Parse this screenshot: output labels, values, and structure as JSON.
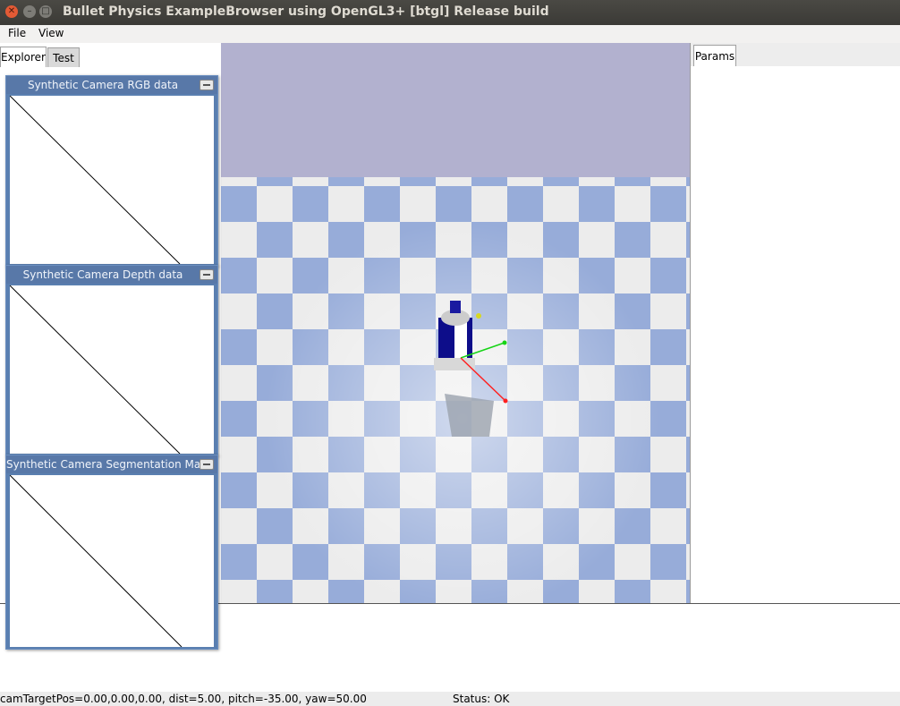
{
  "window": {
    "title": "Bullet Physics ExampleBrowser using OpenGL3+ [btgl] Release build"
  },
  "menu": {
    "file": "File",
    "view": "View"
  },
  "left_tabs": {
    "explorer": "Explorer",
    "test": "Test"
  },
  "right_tabs": {
    "params": "Params"
  },
  "camera_windows": [
    {
      "title": "Synthetic Camera RGB data"
    },
    {
      "title": "Synthetic Camera Depth data"
    },
    {
      "title": "Synthetic Camera Segmentation Mask"
    }
  ],
  "status": {
    "camera": "camTargetPos=0.00,0.00,0.00, dist=5.00, pitch=-35.00, yaw=50.00",
    "state": "Status: OK"
  },
  "colors": {
    "sky": "#b2b1cf",
    "floor_blue": "#97acd9",
    "floor_white": "#ececec",
    "panel_header": "#5878a8"
  }
}
